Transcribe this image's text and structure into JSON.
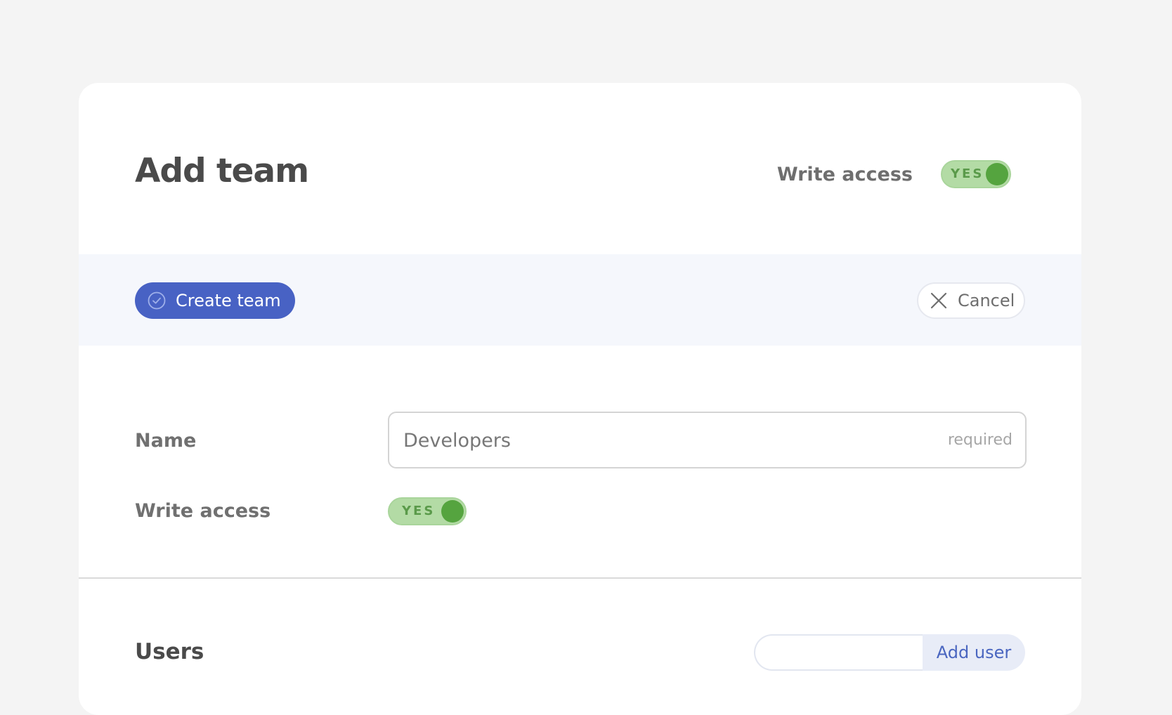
{
  "header": {
    "title": "Add team",
    "write_access_label": "Write access",
    "write_access_toggle": "YES"
  },
  "actions": {
    "create_label": "Create team",
    "cancel_label": "Cancel"
  },
  "form": {
    "name_label": "Name",
    "name_value": "Developers",
    "name_hint": "required",
    "write_access_label": "Write access",
    "write_access_toggle": "YES"
  },
  "users": {
    "title": "Users",
    "add_user_input_value": "",
    "add_user_label": "Add user"
  },
  "colors": {
    "primary": "#4862c4",
    "toggle_on_bg": "#b3dba5",
    "toggle_on_knob": "#55a43f",
    "action_bar_bg": "#f5f7fc"
  },
  "icons": {
    "create": "check-circle-icon",
    "cancel": "close-icon"
  }
}
